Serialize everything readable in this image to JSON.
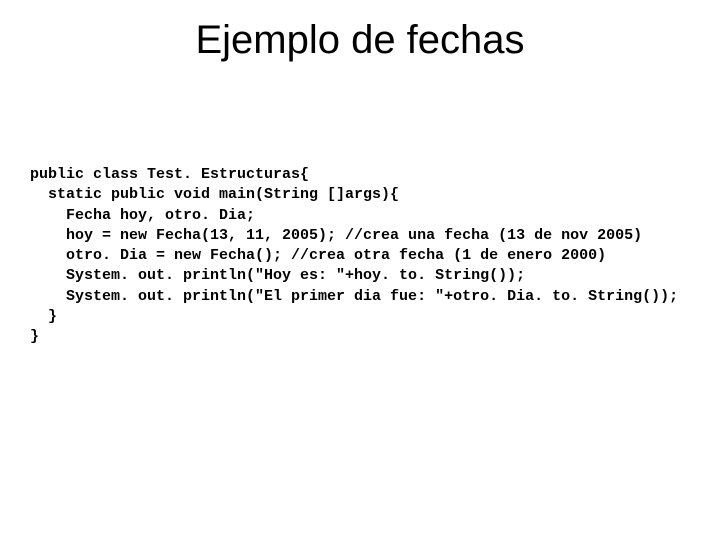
{
  "slide": {
    "title": "Ejemplo de fechas",
    "code": {
      "l1": "public class Test. Estructuras{",
      "l2": "  static public void main(String []args){",
      "l3": "    Fecha hoy, otro. Dia;",
      "l4": "    hoy = new Fecha(13, 11, 2005); //crea una fecha (13 de nov 2005)",
      "l5": "    otro. Dia = new Fecha(); //crea otra fecha (1 de enero 2000)",
      "l6": "    System. out. println(\"Hoy es: \"+hoy. to. String());",
      "l7": "    System. out. println(\"El primer dia fue: \"+otro. Dia. to. String());",
      "l8": "  }",
      "l9": "}"
    }
  }
}
